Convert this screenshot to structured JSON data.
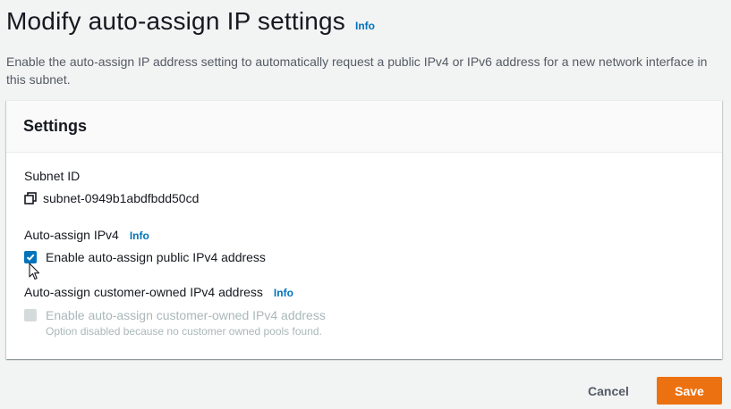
{
  "header": {
    "title": "Modify auto-assign IP settings",
    "info_label": "Info",
    "description": "Enable the auto-assign IP address setting to automatically request a public IPv4 or IPv6 address for a new network interface in this subnet."
  },
  "settings": {
    "title": "Settings",
    "subnet": {
      "label": "Subnet ID",
      "value": "subnet-0949b1abdfbdd50cd",
      "icon": "copy-icon"
    },
    "ipv4": {
      "label": "Auto-assign IPv4",
      "info_label": "Info",
      "checkbox_label": "Enable auto-assign public IPv4 address",
      "checked": true
    },
    "customer_owned": {
      "label": "Auto-assign customer-owned IPv4 address",
      "info_label": "Info",
      "checkbox_label": "Enable auto-assign customer-owned IPv4 address",
      "checked": false,
      "disabled": true,
      "helper": "Option disabled because no customer owned pools found."
    }
  },
  "footer": {
    "cancel_label": "Cancel",
    "save_label": "Save"
  },
  "colors": {
    "link": "#0073bb",
    "primary_button": "#ec7211",
    "checkbox_checked": "#0073bb",
    "background": "#f2f3f3"
  }
}
